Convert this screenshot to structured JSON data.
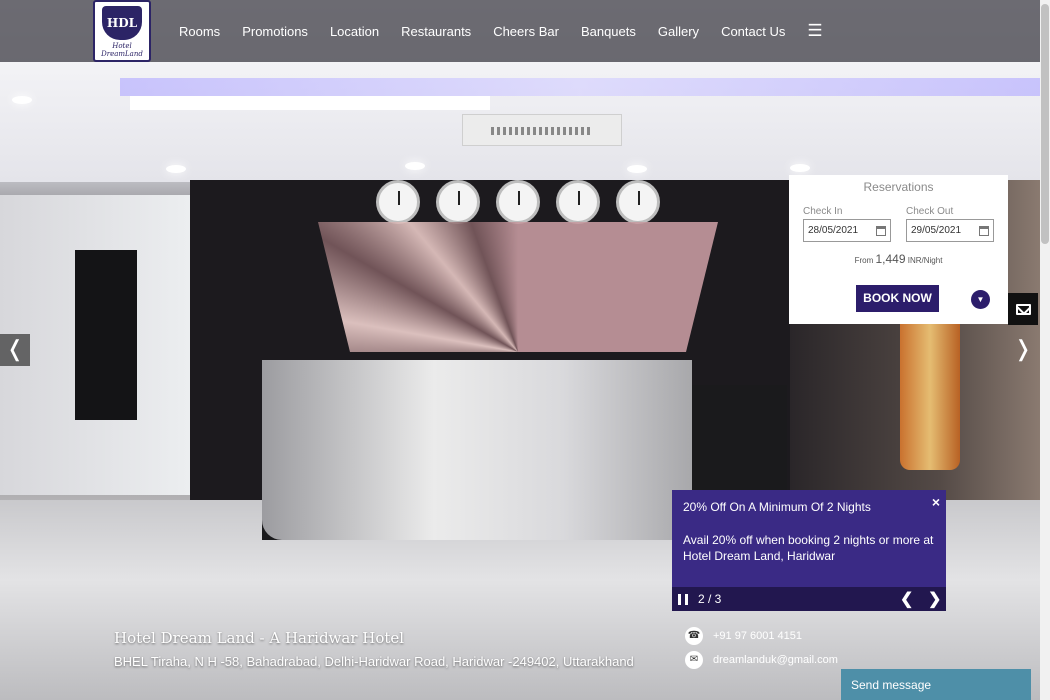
{
  "header": {
    "logo_text": "HDL",
    "logo_caption": "Hotel DreamLand",
    "nav": [
      "Rooms",
      "Promotions",
      "Location",
      "Restaurants",
      "Cheers Bar",
      "Banquets",
      "Gallery",
      "Contact Us"
    ],
    "menu_icon": "hamburger-icon"
  },
  "slider": {
    "prev": "❬",
    "next": "❭"
  },
  "reservations": {
    "title": "Reservations",
    "check_in_label": "Check In",
    "check_in_value": "28/05/2021",
    "check_out_label": "Check Out",
    "check_out_value": "29/05/2021",
    "price_prefix": "From",
    "price_amount": "1,449",
    "price_suffix": "INR/Night",
    "book_label": "BOOK NOW"
  },
  "promo": {
    "title": "20% Off On A Minimum Of 2 Nights",
    "text": "Avail 20% off when booking 2 nights or more at Hotel Dream Land, Haridwar",
    "close": "×",
    "counter": "2 / 3",
    "prev": "❮",
    "next": "❯"
  },
  "footer": {
    "hotel_name": "Hotel Dream Land - A Haridwar Hotel",
    "address": "BHEL Tiraha, N H -58, Bahadrabad, Delhi-Haridwar Road, Haridwar -249402, Uttarakhand",
    "phone": "+91 97 6001 4151",
    "email": "dreamlanduk@gmail.com",
    "send_message": "Send message"
  },
  "colors": {
    "brand": "#2c1d6b",
    "promo_bg": "#3a2a85",
    "chat": "#4e8fa8"
  }
}
